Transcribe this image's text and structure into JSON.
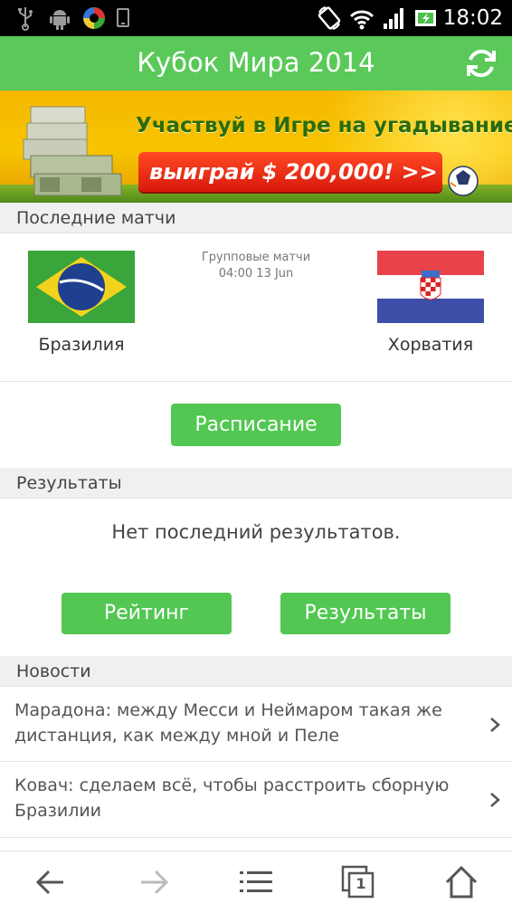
{
  "status_bar": {
    "time": "18:02",
    "icons": [
      "usb-icon",
      "android-icon",
      "app-icon",
      "phone-icon",
      "rotate-icon",
      "wifi-icon",
      "signal-icon",
      "battery-charging-icon"
    ]
  },
  "app_bar": {
    "title": "Кубок Мира 2014",
    "refresh_icon": "refresh-icon",
    "color": "#5ac95a"
  },
  "banner": {
    "headline": "Участвуй в Игре на угадывание",
    "cta": "выиграй $ 200,000! >>"
  },
  "last_matches": {
    "heading": "Последние матчи",
    "stage": "Групповые матчи",
    "datetime": "04:00 13 Jun",
    "home_team": "Бразилия",
    "away_team": "Хорватия",
    "schedule_button": "Расписание"
  },
  "results": {
    "heading": "Результаты",
    "empty_text": "Нет последний результатов.",
    "rating_button": "Рейтинг",
    "results_button": "Результаты"
  },
  "news": {
    "heading": "Новости",
    "items": [
      {
        "text": "Марадона: между Месси и Неймаром такая же дистанция, как между мной и Пеле"
      },
      {
        "text": "Ковач: сделаем всё, чтобы расстроить сборную Бразилии"
      }
    ]
  },
  "bottom_nav": {
    "icons": [
      "back-arrow-icon",
      "forward-arrow-icon",
      "menu-icon",
      "tabs-icon",
      "home-icon"
    ],
    "tab_count": "1"
  },
  "colors": {
    "accent_green": "#52c752",
    "section_bg": "#f0f0f0"
  }
}
